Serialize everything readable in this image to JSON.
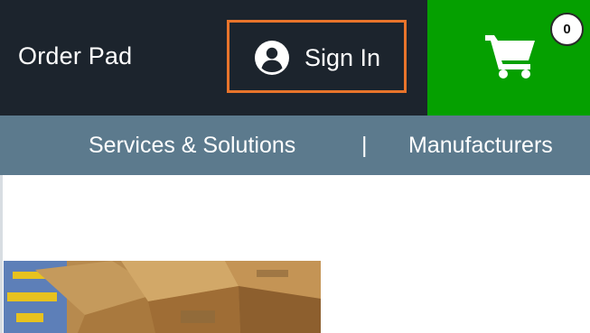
{
  "header": {
    "order_pad_label": "Order Pad",
    "sign_in_label": "Sign In",
    "cart_count": "0"
  },
  "nav": {
    "services_label": "Services & Solutions",
    "separator": "|",
    "manufacturers_label": "Manufacturers"
  },
  "colors": {
    "header_bg": "#1c242d",
    "nav_bg": "#5c7a8d",
    "cart_bg": "#05a000",
    "highlight_border": "#e8742b"
  },
  "icons": {
    "user": "user-circle-icon",
    "cart": "shopping-cart-icon"
  }
}
